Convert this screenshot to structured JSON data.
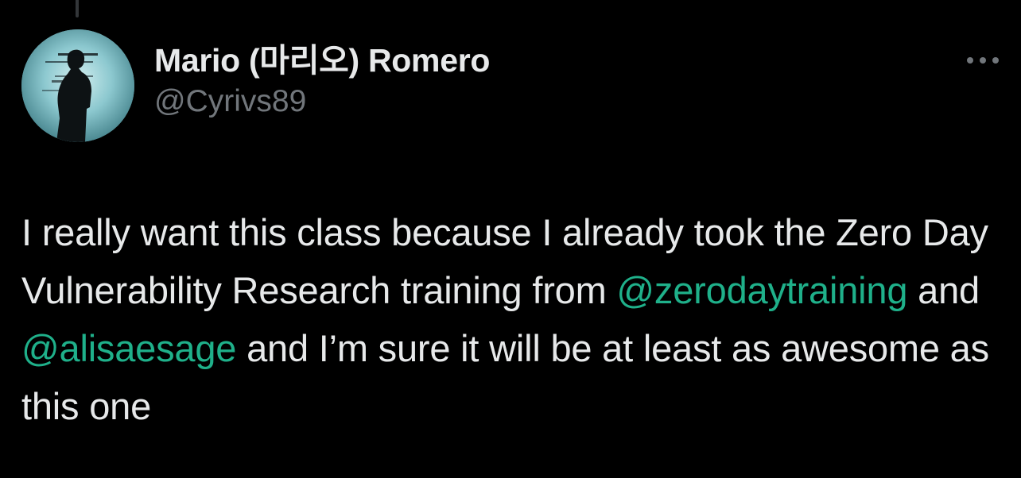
{
  "tweet": {
    "author": {
      "display_name": "Mario (마리오) Romero",
      "handle": "@Cyrivs89",
      "avatar_icon": "avatar-silhouette-icon"
    },
    "more_icon": "more-options-icon",
    "text": {
      "part1": "I really want this class because I already took the Zero Day Vulnerability Research training from ",
      "mention1": "@zerodaytraining",
      "part2": " and ",
      "mention2": "@alisaesage",
      "part3": " and I’m sure it will be at least as awesome as this one"
    }
  },
  "colors": {
    "background": "#000000",
    "text": "#e7e9ea",
    "secondary_text": "#71767b",
    "mention": "#1fb08a",
    "thread_line": "#333639"
  }
}
